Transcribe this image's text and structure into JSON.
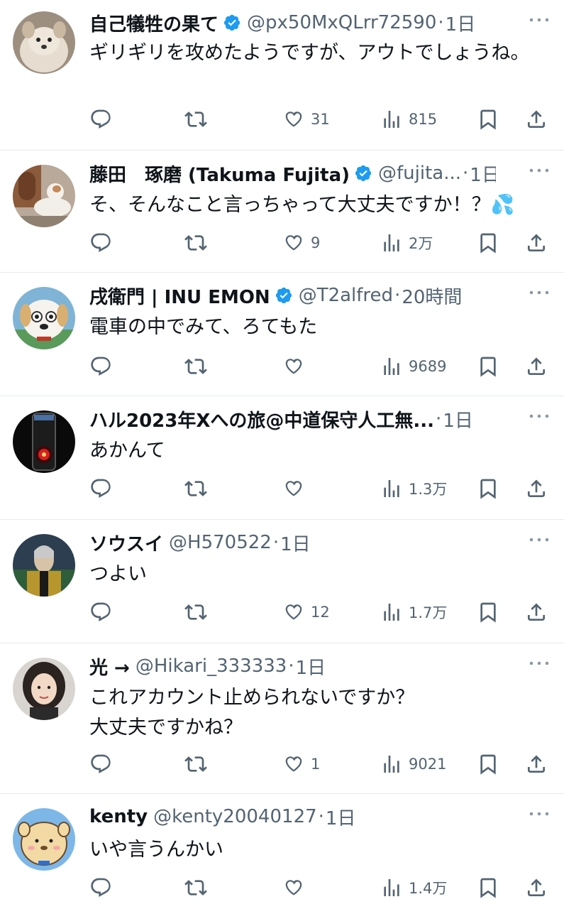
{
  "tweets": [
    {
      "name": "自己犠牲の果て",
      "verified": true,
      "handle": "@px50MxQLrr72590",
      "sep": "·",
      "time": "1日",
      "text": "ギリギリを攻めたようですが、アウトでしょうね。",
      "replies": "",
      "retweets": "",
      "likes": "31",
      "views": "815"
    },
    {
      "name": "藤田　琢磨 (Takuma Fujita)",
      "verified": true,
      "handle": "@fujita...",
      "sep": "·",
      "time": "1日",
      "text": "そ、そんなこと言っちゃって大丈夫ですか！？💦",
      "replies": "",
      "retweets": "",
      "likes": "9",
      "views": "2万"
    },
    {
      "name": "戌衛門 | INU EMON",
      "verified": true,
      "handle": "@T2alfred",
      "sep": "·",
      "time": "20時間",
      "text": "電車の中でみて、ろてもた",
      "replies": "",
      "retweets": "",
      "likes": "",
      "views": "9689"
    },
    {
      "name": "ハル2023年Xへの旅@中道保守人工無...",
      "verified": false,
      "handle": "",
      "sep": "·",
      "time": "1日",
      "text": "あかんて",
      "replies": "",
      "retweets": "",
      "likes": "",
      "views": "1.3万"
    },
    {
      "name": "ソウスイ",
      "verified": false,
      "handle": "@H570522",
      "sep": "·",
      "time": "1日",
      "text": "つよい",
      "replies": "",
      "retweets": "",
      "likes": "12",
      "views": "1.7万"
    },
    {
      "name": "光 →",
      "verified": false,
      "handle": "@Hikari_333333",
      "sep": "·",
      "time": "1日",
      "text": "これアカウント止められないですか？\n大丈夫ですかね？",
      "replies": "",
      "retweets": "",
      "likes": "1",
      "views": "9021"
    },
    {
      "name": "kenty",
      "verified": false,
      "handle": "@kenty20040127",
      "sep": "·",
      "time": "1日",
      "text": "いや言うんかい",
      "replies": "",
      "retweets": "",
      "likes": "",
      "views": "1.4万"
    }
  ],
  "icons": {
    "reply": "speech-bubble-icon",
    "retweet": "repost-arrows-icon",
    "like": "heart-icon",
    "views": "bar-chart-icon",
    "bookmark": "bookmark-icon",
    "share": "share-upload-icon",
    "more": "ellipsis-icon",
    "verified": "verified-badge-icon"
  },
  "colors": {
    "text": "#0f1419",
    "secondary": "#536471",
    "verified": "#1d9bf0",
    "divider": "#e6e9eb"
  }
}
